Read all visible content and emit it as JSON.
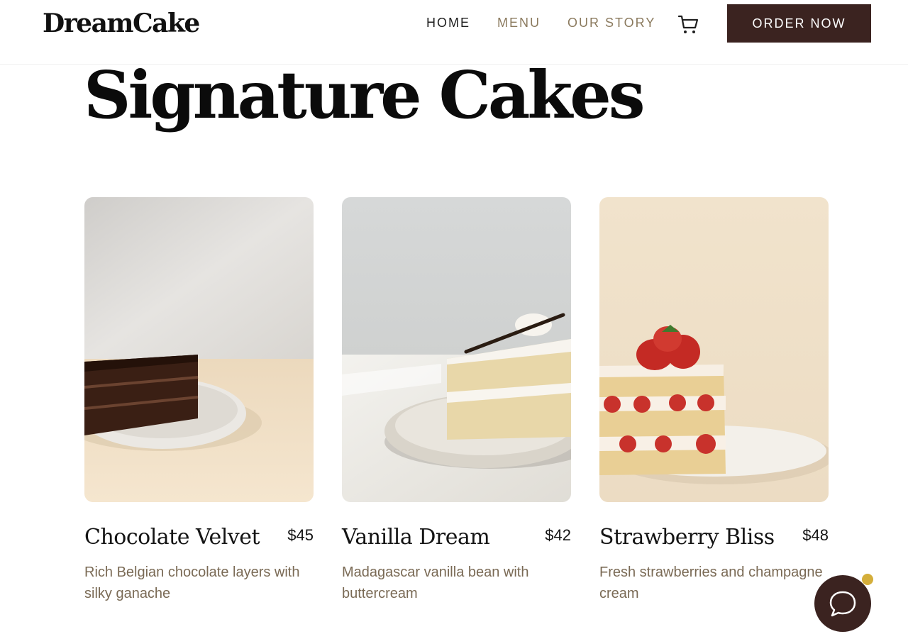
{
  "brand": {
    "name": "DreamCake"
  },
  "nav": {
    "home": "HOME",
    "menu": "MENU",
    "story": "OUR STORY"
  },
  "header": {
    "order_label": "ORDER NOW",
    "cart_icon": "cart-icon"
  },
  "page": {
    "title": "Signature Cakes"
  },
  "cakes": [
    {
      "name": "Chocolate Velvet",
      "price": "$45",
      "description": "Rich Belgian chocolate layers with silky ganache"
    },
    {
      "name": "Vanilla Dream",
      "price": "$42",
      "description": "Madagascar vanilla bean with buttercream"
    },
    {
      "name": "Strawberry Bliss",
      "price": "$48",
      "description": "Fresh strawberries and champagne cream"
    }
  ],
  "chat": {
    "icon": "chat-bubble-icon",
    "dot_color": "#d4ae3a"
  },
  "colors": {
    "brand_dark": "#3b2320",
    "muted_text": "#8b7a5e"
  }
}
